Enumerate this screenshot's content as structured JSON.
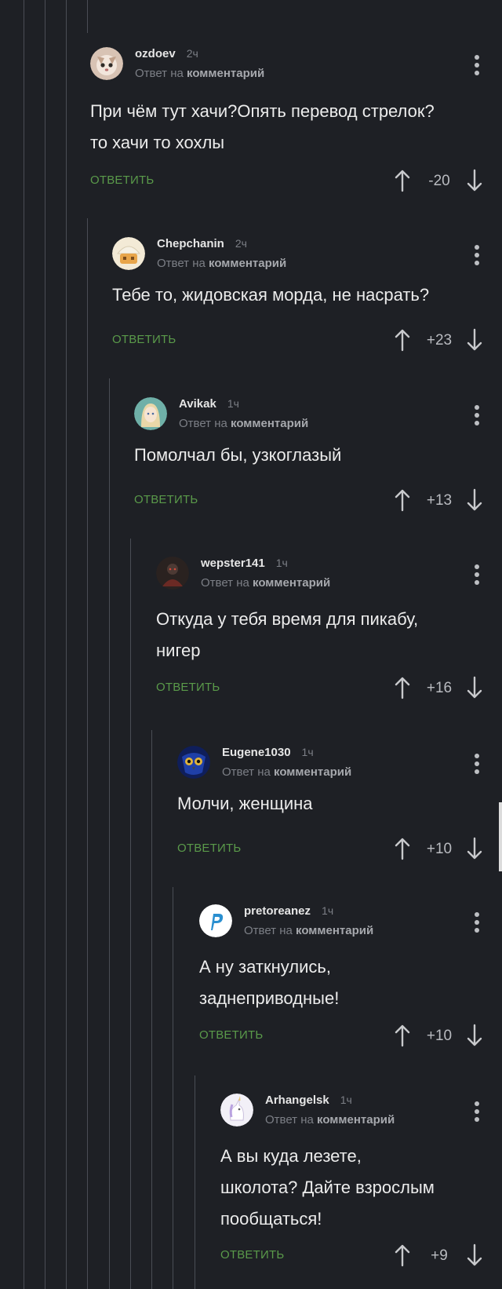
{
  "comments": [
    {
      "username": "ozdoev",
      "time": "2ч",
      "reply_prefix": "Ответ на",
      "reply_target": "комментарий",
      "text_lines": [
        "При чём тут хачи?Опять перевод стрелок?",
        "то хачи то хохлы"
      ],
      "reply_label": "ОТВЕТИТЬ",
      "rating": "-20",
      "avatar_icon": "cat-avatar-icon"
    },
    {
      "username": "Chepchanin",
      "time": "2ч",
      "reply_prefix": "Ответ на",
      "reply_target": "комментарий",
      "text_lines": [
        "Тебе то, жидовская морда, не насрать?"
      ],
      "reply_label": "ОТВЕТИТЬ",
      "rating": "+23",
      "avatar_icon": "cartoon-face-avatar-icon"
    },
    {
      "username": "Avikak",
      "time": "1ч",
      "reply_prefix": "Ответ на",
      "reply_target": "комментарий",
      "text_lines": [
        "Помолчал бы, узкоглазый"
      ],
      "reply_label": "ОТВЕТИТЬ",
      "rating": "+13",
      "avatar_icon": "anime-girl-avatar-icon"
    },
    {
      "username": "wepster141",
      "time": "1ч",
      "reply_prefix": "Ответ на",
      "reply_target": "комментарий",
      "text_lines": [
        "Откуда у тебя время для пикабу,",
        "нигер"
      ],
      "reply_label": "ОТВЕТИТЬ",
      "rating": "+16",
      "avatar_icon": "dark-figure-avatar-icon"
    },
    {
      "username": "Eugene1030",
      "time": "1ч",
      "reply_prefix": "Ответ на",
      "reply_target": "комментарий",
      "text_lines": [
        "Молчи, женщина"
      ],
      "reply_label": "ОТВЕТИТЬ",
      "rating": "+10",
      "avatar_icon": "owl-avatar-icon"
    },
    {
      "username": "pretoreanez",
      "time": "1ч",
      "reply_prefix": "Ответ на",
      "reply_target": "комментарий",
      "text_lines": [
        "А ну заткнулись,",
        "заднеприводные!"
      ],
      "reply_label": "ОТВЕТИТЬ",
      "rating": "+10",
      "avatar_icon": "letter-p-avatar-icon"
    },
    {
      "username": "Arhangelsk",
      "time": "1ч",
      "reply_prefix": "Ответ на",
      "reply_target": "комментарий",
      "text_lines": [
        "А вы куда лезете,",
        "школота? Дайте взрослым",
        "пообщаться!"
      ],
      "reply_label": "ОТВЕТИТЬ",
      "rating": "+9",
      "avatar_icon": "unicorn-avatar-icon"
    }
  ],
  "colors": {
    "background": "#1e2025",
    "thread_line": "#4a4d55",
    "reply_green": "#5a9a4a",
    "text": "#ececec",
    "meta": "#7c7f86"
  }
}
